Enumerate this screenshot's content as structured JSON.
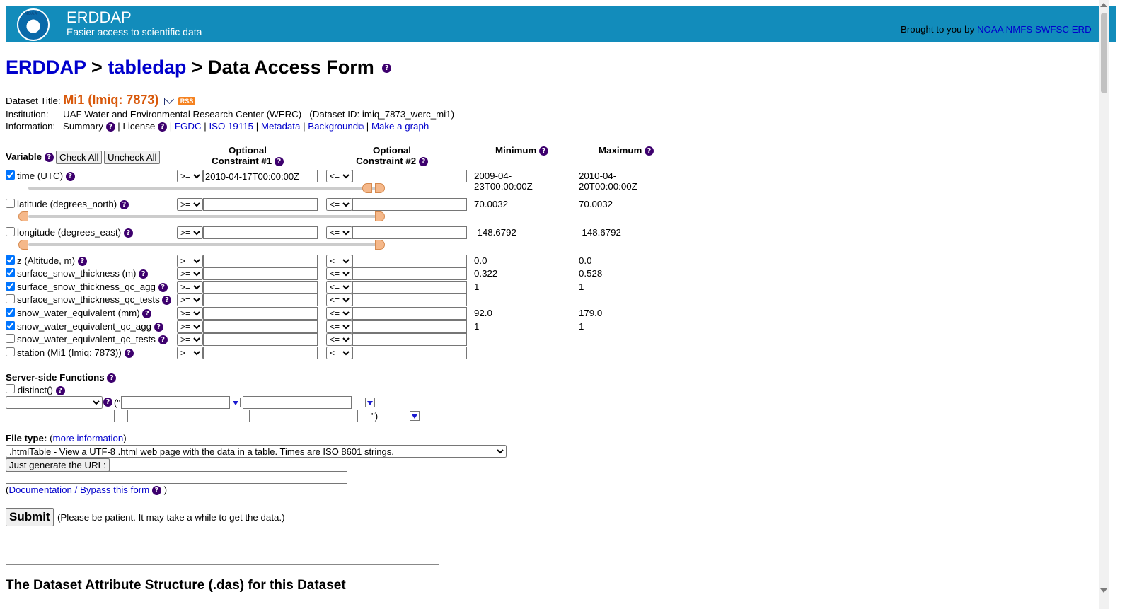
{
  "header": {
    "logo_text": "NOAA",
    "site_name": "ERDDAP",
    "tagline": "Easier access to scientific data",
    "brought_by": "Brought to you by",
    "brought_links": [
      "NOAA",
      "NMFS",
      "SWFSC",
      "ERD"
    ]
  },
  "breadcrumb": {
    "erddap": "ERDDAP",
    "sep1": " > ",
    "tabledap": "tabledap",
    "current": " > Data Access Form"
  },
  "dataset": {
    "title_label": "Dataset Title:",
    "title": "Mi1 (Imiq: 7873)",
    "rss": "RSS",
    "institution_label": "Institution:",
    "institution": "UAF Water and Environmental Research Center (WERC)   (Dataset ID: imiq_7873_werc_mi1)",
    "information_label": "Information:",
    "summary": "Summary",
    "license": "License",
    "links": [
      "FGDC",
      "ISO 19115",
      "Metadata",
      "Background",
      "Make a graph"
    ],
    "sep": "|"
  },
  "table": {
    "variable_header": "Variable",
    "check_all": "Check All",
    "uncheck_all": "Uncheck All",
    "constraint1_header_1": "Optional",
    "constraint1_header_2": "Constraint #1",
    "constraint2_header_1": "Optional",
    "constraint2_header_2": "Constraint #2",
    "min_header": "Minimum",
    "max_header": "Maximum",
    "op1": ">=",
    "op2": "<=",
    "rows": [
      {
        "name": "time (UTC)",
        "checked": true,
        "c1": "2010-04-17T00:00:00Z",
        "c2": "",
        "min": "2009-04-23T00:00:00Z",
        "max": "2010-04-20T00:00:00Z",
        "slider": [
          0.97,
          1.0
        ]
      },
      {
        "name": "latitude (degrees_north)",
        "checked": false,
        "c1": "",
        "c2": "",
        "min": "70.0032",
        "max": "70.0032",
        "slider": [
          0.0,
          1.0
        ]
      },
      {
        "name": "longitude (degrees_east)",
        "checked": false,
        "c1": "",
        "c2": "",
        "min": "-148.6792",
        "max": "-148.6792",
        "slider": [
          0.0,
          1.0
        ]
      },
      {
        "name": "z (Altitude, m)",
        "checked": true,
        "c1": "",
        "c2": "",
        "min": "0.0",
        "max": "0.0"
      },
      {
        "name": "surface_snow_thickness (m)",
        "checked": true,
        "c1": "",
        "c2": "",
        "min": "0.322",
        "max": "0.528"
      },
      {
        "name": "surface_snow_thickness_qc_agg",
        "checked": true,
        "c1": "",
        "c2": "",
        "min": "1",
        "max": "1"
      },
      {
        "name": "surface_snow_thickness_qc_tests",
        "checked": false,
        "c1": "",
        "c2": "",
        "min": "",
        "max": ""
      },
      {
        "name": "snow_water_equivalent (mm)",
        "checked": true,
        "c1": "",
        "c2": "",
        "min": "92.0",
        "max": "179.0"
      },
      {
        "name": "snow_water_equivalent_qc_agg",
        "checked": true,
        "c1": "",
        "c2": "",
        "min": "1",
        "max": "1"
      },
      {
        "name": "snow_water_equivalent_qc_tests",
        "checked": false,
        "c1": "",
        "c2": "",
        "min": "",
        "max": ""
      },
      {
        "name": "station (Mi1 (Imiq: 7873))",
        "checked": false,
        "c1": "",
        "c2": "",
        "min": "",
        "max": ""
      }
    ]
  },
  "server_functions": {
    "title": "Server-side Functions",
    "distinct": "distinct()",
    "open_quote": "(\"",
    "close_quote": "\")"
  },
  "file_type": {
    "label": "File type:",
    "more_open": "(",
    "more": "more information",
    "more_close": ")",
    "selected": ".htmlTable - View a UTF-8 .html web page with the data in a table. Times are ISO 8601 strings.",
    "generate_url": "Just generate the URL:",
    "url_value": "",
    "doc_open": "(",
    "doc_link": "Documentation / Bypass this form",
    "doc_close": " )"
  },
  "submit": {
    "label": "Submit",
    "note": "(Please be patient. It may take a while to get the data.)"
  },
  "das_title": "The Dataset Attribute Structure (.das) for this Dataset"
}
